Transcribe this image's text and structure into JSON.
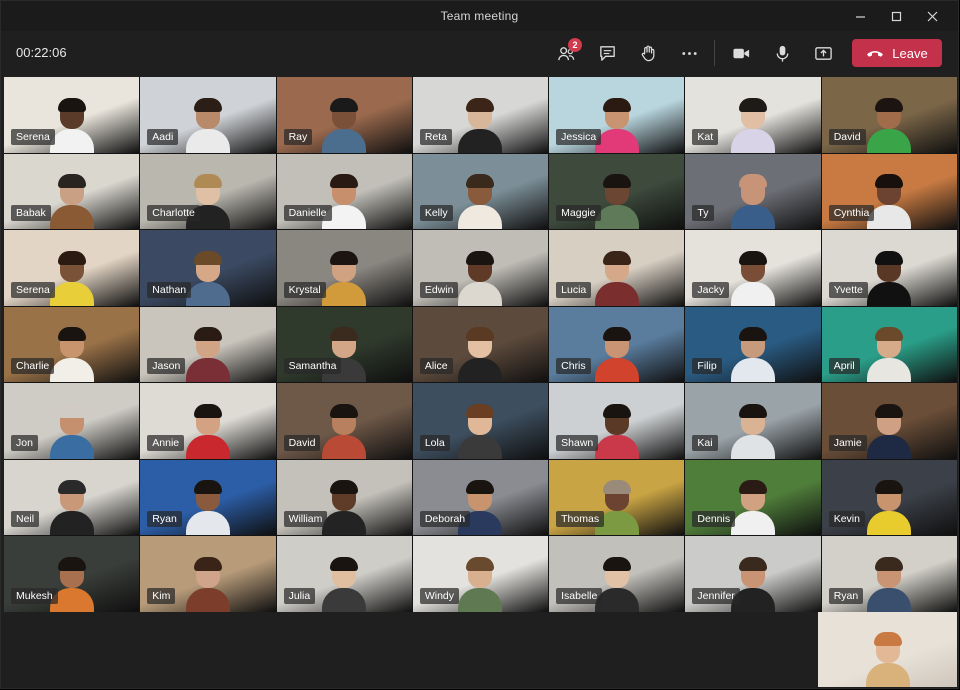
{
  "window": {
    "title": "Team meeting"
  },
  "toolbar": {
    "timer": "00:22:06",
    "participants_badge": "2",
    "leave_label": "Leave"
  },
  "colors": {
    "leave": "#c4314b",
    "badge": "#d03b4d",
    "background": "#1f1f1f"
  },
  "participants": [
    {
      "name": "Serena",
      "bg": "#e9e5dc",
      "skin": "#5a3a28",
      "shirt": "#f2f2f2",
      "hair": "#1a1410"
    },
    {
      "name": "Aadi",
      "bg": "#cfd2d6",
      "skin": "#b88a6a",
      "shirt": "#eaeaea",
      "hair": "#2a1e16"
    },
    {
      "name": "Ray",
      "bg": "#9b6a4e",
      "skin": "#7a5038",
      "shirt": "#4b6e8e",
      "hair": "#1a1a1a"
    },
    {
      "name": "Reta",
      "bg": "#d7d8d6",
      "skin": "#d8b69a",
      "shirt": "#222222",
      "hair": "#3b2418"
    },
    {
      "name": "Jessica",
      "bg": "#b9d6df",
      "skin": "#c79370",
      "shirt": "#e23a78",
      "hair": "#2b1a12"
    },
    {
      "name": "Kat",
      "bg": "#e4e2dd",
      "skin": "#e1bfa4",
      "shirt": "#d9d3e8",
      "hair": "#1e1a18"
    },
    {
      "name": "David",
      "bg": "#7b6648",
      "skin": "#a16c4a",
      "shirt": "#3aa548",
      "hair": "#1c1410"
    },
    {
      "name": "Babak",
      "bg": "#dad7cf",
      "skin": "#caa084",
      "shirt": "#8a5a34",
      "hair": "#2a2420"
    },
    {
      "name": "Charlotte",
      "bg": "#b9b7ae",
      "skin": "#e0c0a4",
      "shirt": "#222222",
      "hair": "#b08a55"
    },
    {
      "name": "Danielle",
      "bg": "#c1bfb8",
      "skin": "#c78f6c",
      "shirt": "#f3f3f3",
      "hair": "#2a1a14"
    },
    {
      "name": "Kelly",
      "bg": "#7c8f98",
      "skin": "#8a5a3c",
      "shirt": "#efe9df",
      "hair": "#3a2a1c"
    },
    {
      "name": "Maggie",
      "bg": "#3d4a3c",
      "skin": "#6b4632",
      "shirt": "#5f7a58",
      "hair": "#1a1410"
    },
    {
      "name": "Ty",
      "bg": "#6d6f76",
      "skin": "#c89478",
      "shirt": "#3a5e8a",
      "hair": "#c89478"
    },
    {
      "name": "Cynthia",
      "bg": "#c87a42",
      "skin": "#6b4330",
      "shirt": "#e8e8e8",
      "hair": "#17100c"
    },
    {
      "name": "Serena",
      "bg": "#e3d5c5",
      "skin": "#7a5238",
      "shirt": "#e8cf3a",
      "hair": "#2a1a12"
    },
    {
      "name": "Nathan",
      "bg": "#3b4a62",
      "skin": "#d6a888",
      "shirt": "#4f6b8e",
      "hair": "#6b4a2a"
    },
    {
      "name": "Krystal",
      "bg": "#8a8680",
      "skin": "#d0a282",
      "shirt": "#d19a3a",
      "hair": "#1c1410"
    },
    {
      "name": "Edwin",
      "bg": "#c0bdb6",
      "skin": "#5f3a26",
      "shirt": "#dcd8d0",
      "hair": "#1a1410"
    },
    {
      "name": "Lucia",
      "bg": "#d8cfc3",
      "skin": "#d4a888",
      "shirt": "#7a2e2e",
      "hair": "#3a2418"
    },
    {
      "name": "Jacky",
      "bg": "#e5e2dc",
      "skin": "#7a4e36",
      "shirt": "#f0f0f0",
      "hair": "#1a1410"
    },
    {
      "name": "Yvette",
      "bg": "#dcd9d2",
      "skin": "#5a3826",
      "shirt": "#111111",
      "hair": "#111111"
    },
    {
      "name": "Charlie",
      "bg": "#9a7248",
      "skin": "#c8946e",
      "shirt": "#f2efe8",
      "hair": "#1a1410"
    },
    {
      "name": "Jason",
      "bg": "#c9c5bc",
      "skin": "#d2a486",
      "shirt": "#7a2e36",
      "hair": "#2a1c14"
    },
    {
      "name": "Samantha",
      "bg": "#2f3a2c",
      "skin": "#d4a688",
      "shirt": "#3a3a3a",
      "hair": "#3b2a1e"
    },
    {
      "name": "Alice",
      "bg": "#5c4a3c",
      "skin": "#e4c0a2",
      "shirt": "#222222",
      "hair": "#5a3a22"
    },
    {
      "name": "Chris",
      "bg": "#5a7d9e",
      "skin": "#c89474",
      "shirt": "#d2432e",
      "hair": "#1a1410"
    },
    {
      "name": "Filip",
      "bg": "#2a5b82",
      "skin": "#c89a7c",
      "shirt": "#e2e8ee",
      "hair": "#1a1410"
    },
    {
      "name": "April",
      "bg": "#2a9e88",
      "skin": "#d6ab8a",
      "shirt": "#e8e6e0",
      "hair": "#6a4a2a"
    },
    {
      "name": "Jon",
      "bg": "#cfccc6",
      "skin": "#c4906e",
      "shirt": "#3a6ea2",
      "hair": "#d0cbc4"
    },
    {
      "name": "Annie",
      "bg": "#dedbd5",
      "skin": "#d2a282",
      "shirt": "#c8282e",
      "hair": "#1a1410"
    },
    {
      "name": "David",
      "bg": "#6e5848",
      "skin": "#b8805e",
      "shirt": "#b84a36",
      "hair": "#1a1410"
    },
    {
      "name": "Lola",
      "bg": "#3d4e5e",
      "skin": "#e0b898",
      "shirt": "#3a3a3a",
      "hair": "#6a3e22"
    },
    {
      "name": "Shawn",
      "bg": "#cdd0d2",
      "skin": "#5a3a26",
      "shirt": "#c9394a",
      "hair": "#1a1410"
    },
    {
      "name": "Kai",
      "bg": "#9aa3a8",
      "skin": "#dab394",
      "shirt": "#dfe3e6",
      "hair": "#1a1410"
    },
    {
      "name": "Jamie",
      "bg": "#6a4e38",
      "skin": "#d0a084",
      "shirt": "#1e2a44",
      "hair": "#1a1410"
    },
    {
      "name": "Neil",
      "bg": "#d8d5cf",
      "skin": "#c89878",
      "shirt": "#222222",
      "hair": "#2a2a2a"
    },
    {
      "name": "Ryan",
      "bg": "#2c5ea8",
      "skin": "#8a5a3e",
      "shirt": "#e4e8ec",
      "hair": "#1a1410"
    },
    {
      "name": "William",
      "bg": "#c4c1ba",
      "skin": "#5f3c28",
      "shirt": "#232323",
      "hair": "#1a1410"
    },
    {
      "name": "Deborah",
      "bg": "#8a8c92",
      "skin": "#c8946e",
      "shirt": "#2a3a5e",
      "hair": "#1a1410"
    },
    {
      "name": "Thomas",
      "bg": "#c9a444",
      "skin": "#6b4330",
      "shirt": "#7b9a42",
      "hair": "#9a8a7a"
    },
    {
      "name": "Dennis",
      "bg": "#4f7d3a",
      "skin": "#d0a282",
      "shirt": "#f0f0f0",
      "hair": "#2a1c14"
    },
    {
      "name": "Kevin",
      "bg": "#3c4048",
      "skin": "#c8946e",
      "shirt": "#e8cc2e",
      "hair": "#1a1410"
    },
    {
      "name": "Mukesh",
      "bg": "#3a3e3a",
      "skin": "#a8704e",
      "shirt": "#d9782e",
      "hair": "#1a1410"
    },
    {
      "name": "Kim",
      "bg": "#b89c7a",
      "skin": "#d0a48a",
      "shirt": "#7c3e2a",
      "hair": "#3a2418"
    },
    {
      "name": "Julia",
      "bg": "#cfcdc8",
      "skin": "#e0bea0",
      "shirt": "#3a3a3a",
      "hair": "#1a1410"
    },
    {
      "name": "Windy",
      "bg": "#e3e2de",
      "skin": "#d8b090",
      "shirt": "#5f7a52",
      "hair": "#6a4a2e"
    },
    {
      "name": "Isabelle",
      "bg": "#c2c0bb",
      "skin": "#e2c2a6",
      "shirt": "#2a2a2a",
      "hair": "#1a1410"
    },
    {
      "name": "Jennifer",
      "bg": "#cbccc9",
      "skin": "#c89474",
      "shirt": "#222222",
      "hair": "#3a2a1e"
    },
    {
      "name": "Ryan",
      "bg": "#d2d0c8",
      "skin": "#c89474",
      "shirt": "#3a4e6e",
      "hair": "#3a2a1e"
    }
  ],
  "extra_participant": {
    "bg": "#e7e1d8",
    "skin": "#e2b896",
    "shirt": "#d8b27a",
    "hair": "#c87a42"
  }
}
